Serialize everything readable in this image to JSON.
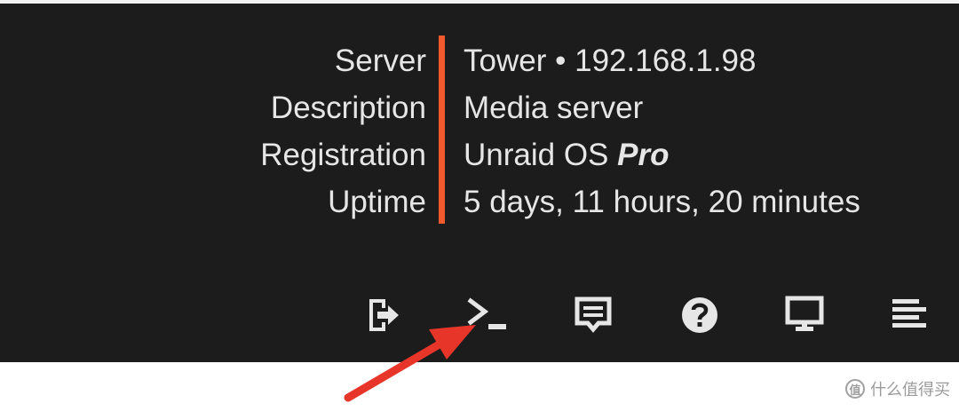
{
  "server_info": {
    "labels": [
      "Server",
      "Description",
      "Registration",
      "Uptime"
    ],
    "server_name": "Tower",
    "separator": "•",
    "server_ip": "192.168.1.98",
    "description": "Media server",
    "registration_prefix": "Unraid OS",
    "registration_tier": "Pro",
    "uptime": "5 days, 11 hours, 20 minutes"
  },
  "toolbar": {
    "icons": [
      "logout-icon",
      "terminal-icon",
      "feedback-icon",
      "help-icon",
      "monitor-icon",
      "log-icon"
    ]
  },
  "annotation": {
    "color": "#e8352a"
  },
  "colors": {
    "header_bg": "#1c1c1c",
    "accent": "#f15a2c",
    "text": "#e6e6e6"
  },
  "watermark": {
    "logo_text": "值",
    "text": "什么值得买"
  }
}
